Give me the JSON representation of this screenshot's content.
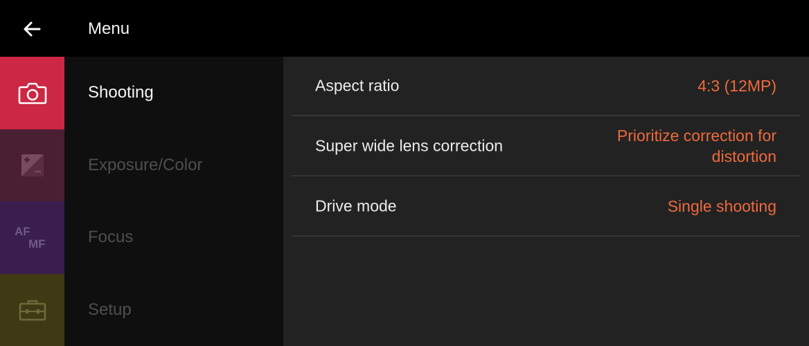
{
  "header": {
    "back_icon": "arrow-left-icon",
    "title": "Menu"
  },
  "rail": {
    "items": [
      {
        "icon": "camera-icon",
        "color": "#cc2743",
        "selected": true
      },
      {
        "icon": "exposure-compensation-icon",
        "color": "#4a1f33",
        "selected": false
      },
      {
        "icon": "af-mf-icon",
        "icon_text_af": "AF",
        "icon_text_mf": "MF",
        "color": "#3a1e4f",
        "selected": false
      },
      {
        "icon": "toolbox-icon",
        "color": "#3f3a14",
        "selected": false
      }
    ]
  },
  "categories": [
    {
      "label": "Shooting",
      "active": true
    },
    {
      "label": "Exposure/Color",
      "active": false
    },
    {
      "label": "Focus",
      "active": false
    },
    {
      "label": "Setup",
      "active": false
    }
  ],
  "settings": [
    {
      "label": "Aspect ratio",
      "value": "4:3 (12MP)"
    },
    {
      "label": "Super wide lens correction",
      "value_line1": "Prioritize correction for",
      "value_line2": "distortion"
    },
    {
      "label": "Drive mode",
      "value": "Single shooting"
    }
  ],
  "colors": {
    "accent": "#ee6a3c",
    "background": "#000000",
    "panel": "#222222"
  }
}
